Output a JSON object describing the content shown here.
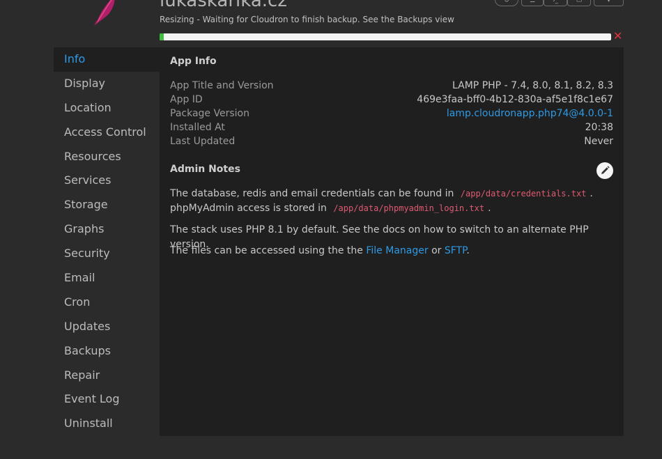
{
  "header": {
    "app_title": "lukaskarika.cz",
    "status_message": "Resizing - Waiting for Cloudron to finish backup. See the Backups view",
    "progress_percent": 1,
    "toolbar_icons": [
      "restart-icon",
      "logs-icon",
      "terminal-icon",
      "files-icon",
      "menu-icon"
    ]
  },
  "sidebar": {
    "items": [
      {
        "label": "Info",
        "active": true
      },
      {
        "label": "Display"
      },
      {
        "label": "Location"
      },
      {
        "label": "Access Control"
      },
      {
        "label": "Resources"
      },
      {
        "label": "Services"
      },
      {
        "label": "Storage"
      },
      {
        "label": "Graphs"
      },
      {
        "label": "Security"
      },
      {
        "label": "Email"
      },
      {
        "label": "Cron"
      },
      {
        "label": "Updates"
      },
      {
        "label": "Backups"
      },
      {
        "label": "Repair"
      },
      {
        "label": "Event Log"
      },
      {
        "label": "Uninstall"
      }
    ]
  },
  "app_info": {
    "title": "App Info",
    "rows": [
      {
        "label": "App Title and Version",
        "value": "LAMP PHP - 7.4, 8.0, 8.1, 8.2, 8.3"
      },
      {
        "label": "App ID",
        "value": "469e3faa-bff0-4b12-830a-af5e1f8c1e67"
      },
      {
        "label": "Package Version",
        "value": "lamp.cloudronapp.php74@4.0.0-1"
      },
      {
        "label": "Installed At",
        "value": "20:38"
      },
      {
        "label": "Last Updated",
        "value": "Never"
      }
    ]
  },
  "admin_notes": {
    "title": "Admin Notes",
    "p1_text1": "The database, redis and email credentials can be found in",
    "p1_code1": "/app/data/credentials.txt",
    "p1_text2": ".",
    "p1_text3": "phpMyAdmin access is stored in",
    "p1_code2": "/app/data/phpmyadmin_login.txt",
    "p1_text4": ".",
    "p2": "The stack uses PHP 8.1 by default. See the docs on how to switch to an alternate PHP version.",
    "p3_text1": "The files can be accessed using the the",
    "p3_link1": "File Manager",
    "p3_text2": "or",
    "p3_link2": "SFTP",
    "p3_text3": "."
  },
  "colors": {
    "accent": "#2f9ae5",
    "progress": "#3ec03e",
    "cancel": "#e5323a",
    "code": "#e05a72"
  }
}
